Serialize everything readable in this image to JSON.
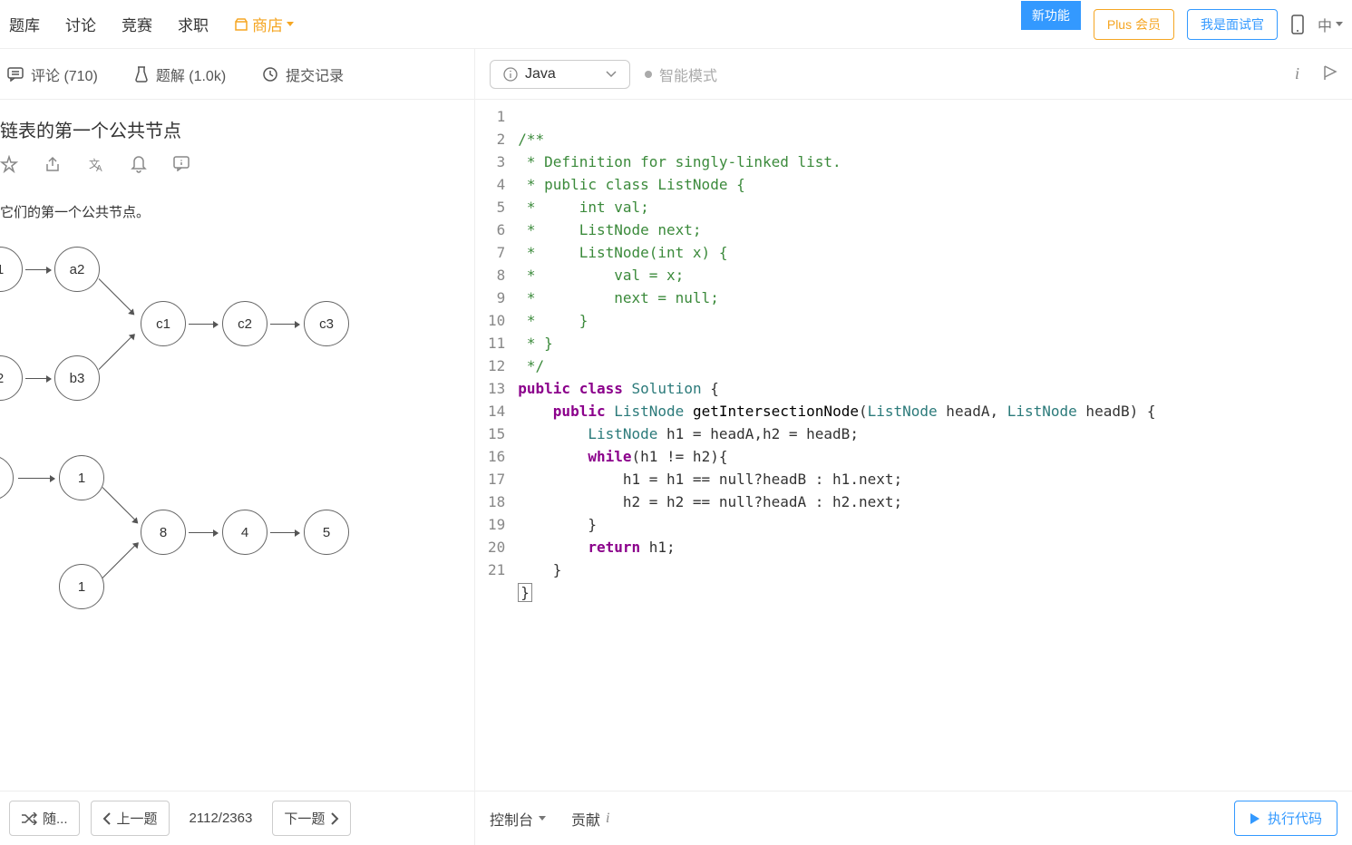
{
  "nav": {
    "items": [
      "题库",
      "讨论",
      "竞赛",
      "求职"
    ],
    "store": "商店",
    "new_feature": "新功能",
    "plus": "Plus 会员",
    "interviewer": "我是面试官",
    "lang": "中"
  },
  "left_tabs": {
    "comments": "评论 (710)",
    "solutions": "题解 (1.0k)",
    "submissions": "提交记录"
  },
  "problem": {
    "title": "链表的第一个公共节点",
    "desc": "它们的第一个公共节点。"
  },
  "diagram1": {
    "nodes": [
      "1",
      "a2",
      "2",
      "b3",
      "c1",
      "c2",
      "c3"
    ]
  },
  "diagram2": {
    "nodes": [
      "1",
      "8",
      "4",
      "5",
      "1"
    ]
  },
  "bottom_left": {
    "shuffle": "随...",
    "prev": "上一题",
    "counter": "2112/2363",
    "next": "下一题"
  },
  "editor": {
    "language": "Java",
    "smart_mode": "智能模式",
    "lines": 21
  },
  "code": {
    "l1": "/**",
    "l2": " * Definition for singly-linked list.",
    "l3": " * public class ListNode {",
    "l4": " *     int val;",
    "l5": " *     ListNode next;",
    "l6": " *     ListNode(int x) {",
    "l7": " *         val = x;",
    "l8": " *         next = null;",
    "l9": " *     }",
    "l10": " * }",
    "l11": " */",
    "l12a": "public",
    "l12b": "class",
    "l12c": "Solution",
    "l12d": " {",
    "l13a": "    ",
    "l13b": "public",
    "l13c": "ListNode",
    "l13d": "getIntersectionNode",
    "l13e": "(",
    "l13f": "ListNode",
    "l13g": " headA, ",
    "l13h": "ListNode",
    "l13i": " headB) {",
    "l14a": "        ",
    "l14b": "ListNode",
    "l14c": " h1 = headA,h2 = headB;",
    "l15a": "        ",
    "l15b": "while",
    "l15c": "(h1 != h2){",
    "l16": "            h1 = h1 == null?headB : h1.next;",
    "l17": "            h2 = h2 == null?headA : h2.next;",
    "l18": "        }",
    "l19a": "        ",
    "l19b": "return",
    "l19c": " h1;",
    "l20": "    }",
    "l21": "}"
  },
  "bottom_right": {
    "console": "控制台",
    "contribute": "贡献",
    "run": "执行代码"
  }
}
